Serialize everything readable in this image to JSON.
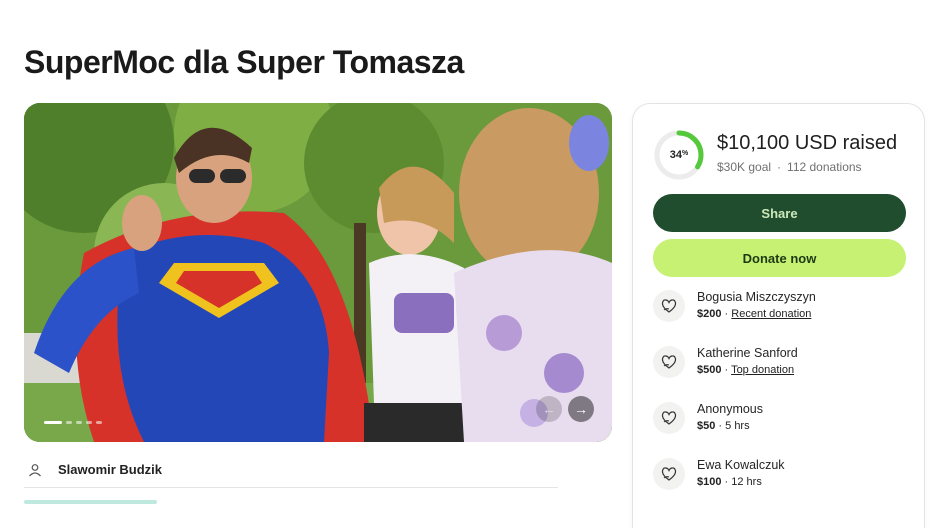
{
  "campaign": {
    "title": "SuperMoc dla Super Tomasza"
  },
  "carousel": {
    "prev_arrow": "←",
    "next_arrow": "→"
  },
  "organizer": {
    "name": "Slawomir Budzik",
    "icon": "person-icon"
  },
  "progress": {
    "percent_value": 34,
    "percent_number": "34",
    "percent_sign": "%",
    "raised": "$10,100 USD raised",
    "goal": "$30K goal",
    "separator": "·",
    "donations_count": "112 donations"
  },
  "actions": {
    "share_label": "Share",
    "donate_label": "Donate now"
  },
  "donations": [
    {
      "name": "Bogusia Miszczyszyn",
      "amount": "$200",
      "sep": " · ",
      "note": "Recent donation",
      "note_is_link": true
    },
    {
      "name": "Katherine Sanford",
      "amount": "$500",
      "sep": " · ",
      "note": "Top donation",
      "note_is_link": true
    },
    {
      "name": "Anonymous",
      "amount": "$50",
      "sep": " · ",
      "note": "5 hrs",
      "note_is_link": false
    },
    {
      "name": "Ewa Kowalczuk",
      "amount": "$100",
      "sep": " · ",
      "note": "12 hrs",
      "note_is_link": false
    }
  ],
  "colors": {
    "share_bg": "#1f4d2e",
    "donate_bg": "#c6f173",
    "progress_ring": "#55c93b"
  }
}
